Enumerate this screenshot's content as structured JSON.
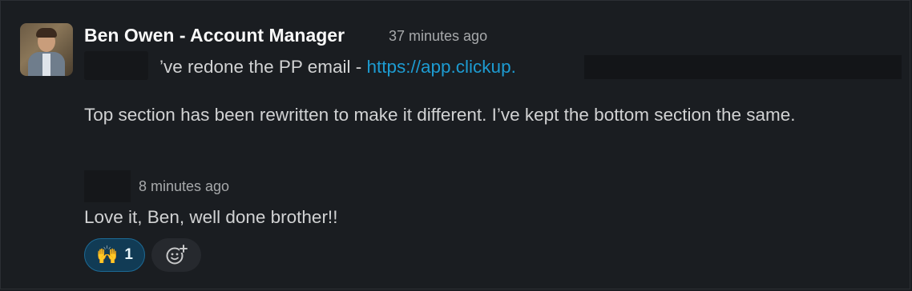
{
  "message1": {
    "author": "Ben Owen - Account Manager",
    "timestamp": "37 minutes ago",
    "line1_text": "’ve redone the PP email - ",
    "link_text": "https://app.clickup.",
    "paragraph": "Top section has been rewritten to make it different. I’ve kept the bottom section the same."
  },
  "message2": {
    "timestamp": "8 minutes ago",
    "text": "Love it, Ben, well done brother!!"
  },
  "reactions": [
    {
      "emoji": "🙌",
      "count": "1"
    }
  ],
  "icons": {
    "add_reaction": "add-reaction-icon"
  },
  "colors": {
    "link": "#1d9bd1",
    "background": "#1a1d21",
    "reaction_bg": "#113b55"
  }
}
